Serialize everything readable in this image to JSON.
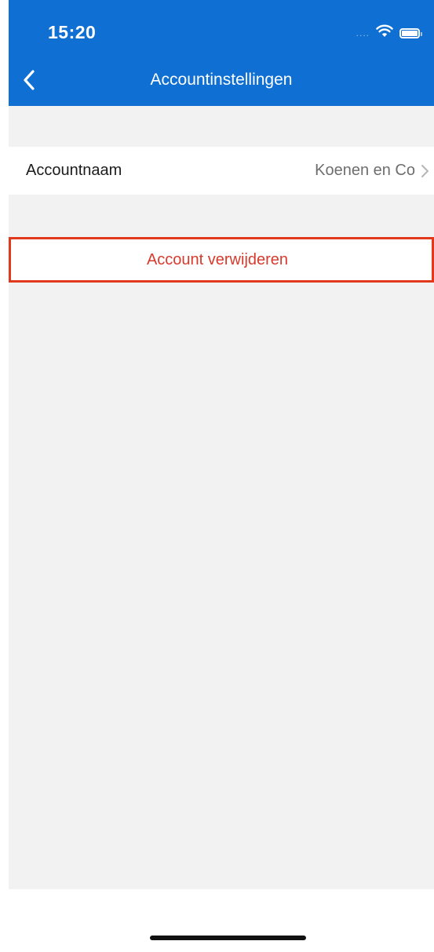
{
  "status_bar": {
    "time": "15:20",
    "signal": "....",
    "icons": [
      "wifi-icon",
      "battery-icon"
    ]
  },
  "header": {
    "title": "Accountinstellingen",
    "back_icon": "chevron-left-icon",
    "background_color": "#0f6fd2"
  },
  "settings": {
    "account_name_label": "Accountnaam",
    "account_name_value": "Koenen en Co",
    "chevron_icon": "chevron-right-icon"
  },
  "actions": {
    "delete_account_label": "Account verwijderen",
    "delete_color": "#d73a2c",
    "highlight_color": "#e0391c"
  }
}
